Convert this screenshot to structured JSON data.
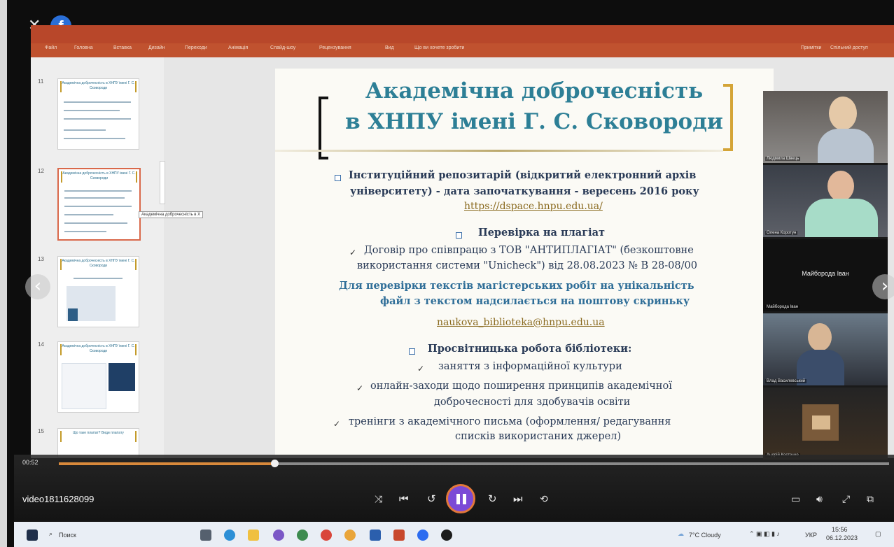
{
  "player": {
    "video_name": "video1811628099",
    "current_time": "00:52",
    "progress": 0.26,
    "state": "paused"
  },
  "ppt": {
    "ribbon_tabs": [
      "Файл",
      "Головна",
      "Вставка",
      "Дизайн",
      "Переходи",
      "Анімація",
      "Слайд-шоу",
      "Рецензування",
      "Вид",
      "Що ви хочете зробити"
    ],
    "comments_label": "Примітки",
    "share_label": "Спільний доступ",
    "thumb_numbers": [
      "11",
      "12",
      "13",
      "14",
      "15"
    ],
    "thumb_titles": [
      "Академічна доброчесність в ХНПУ імені Г. С. Сковороди",
      "Академічна доброчесність в ХНПУ імені Г. С. Сковороди",
      "Академічна доброчесність в ХНПУ імені Г. С. Сковороди",
      "Академічна доброчесність в ХНПУ імені Г. С. Сковороди",
      "Що таке плагіат? Види плагіату"
    ],
    "tooltip": "Академічна доброчесність в Х"
  },
  "slide": {
    "title_line1": "Академічна доброчесність",
    "title_line2": "в ХНПУ імені Г. С. Сковороди",
    "repo_line1": "Інституційний репозитарій (відкритий електронний архів",
    "repo_line2": "університету) - дата започаткування - вересень 2016 року",
    "repo_link": "https://dspace.hnpu.edu.ua/",
    "plag_header": "Перевірка на плагіат",
    "contract_line1": "Договір про співпрацю з ТОВ \"АНТИПЛАГІАТ\" (безкоштовне",
    "contract_line2": "використання системи \"Unicheck\") від 28.08.2023 № В 28-08/00",
    "masters_line1": "Для перевірки текстів магістерських робіт на унікальність",
    "masters_line2": "файл з текстом  надсилається на поштову скриньку",
    "email": "naukova_biblioteka@hnpu.edu.ua",
    "edu_header": "Просвітницька  робота бібліотеки:",
    "edu_item1": "заняття з інформаційної культури",
    "edu_item2_line1": "онлайн-заходи щодо поширення принципів академічної",
    "edu_item2_line2": "доброчесності для здобувачів освіти",
    "edu_item3_line1": "тренінги з академічного письма (оформлення/ редагування",
    "edu_item3_line2": "списків використаних джерел)"
  },
  "participants": [
    {
      "name": "Людмила Швець"
    },
    {
      "name": "Олена Коротун"
    },
    {
      "name": "Майборода Іван",
      "label_big": "Майборода Іван"
    },
    {
      "name": "Влад Василевський"
    },
    {
      "name": "Андрій Костенко"
    }
  ],
  "taskbar": {
    "search_label": "Поиск",
    "weather": "7°C Cloudy",
    "lang": "УКР",
    "time": "15:56",
    "date": "06.12.2023"
  }
}
